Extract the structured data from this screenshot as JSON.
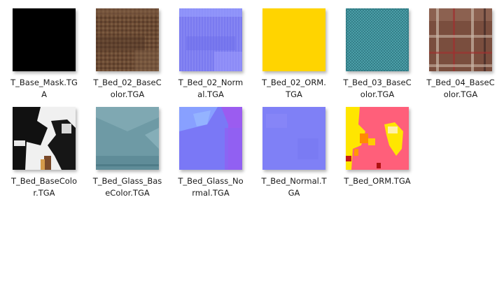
{
  "files": [
    {
      "id": "t-base-mask",
      "label": "T_Base_Mask.TG\nA",
      "swatch": "#000000"
    },
    {
      "id": "t-bed-02-basecolor",
      "label": "T_Bed_02_BaseC\nolor.TGA",
      "swatch": "#6b4a33"
    },
    {
      "id": "t-bed-02-normal",
      "label": "T_Bed_02_Norm\nal.TGA",
      "swatch": "#8080f0"
    },
    {
      "id": "t-bed-02-orm",
      "label": "T_Bed_02_ORM.\nTGA",
      "swatch": "#ffd400"
    },
    {
      "id": "t-bed-03-basecolor",
      "label": "T_Bed_03_BaseC\nolor.TGA",
      "swatch": "#3a8f9a"
    },
    {
      "id": "t-bed-04-basecolor",
      "label": "T_Bed_04_BaseC\nolor.TGA",
      "swatch": "#7a4a3c"
    },
    {
      "id": "t-bed-basecolor",
      "label": "T_Bed_BaseColo\nr.TGA",
      "swatch": "#f2f2f2"
    },
    {
      "id": "t-bed-glass-basecolor",
      "label": "T_Bed_Glass_Bas\neColor.TGA",
      "swatch": "#6f9aa6"
    },
    {
      "id": "t-bed-glass-normal",
      "label": "T_Bed_Glass_No\nrmal.TGA",
      "swatch": "#7a78f5"
    },
    {
      "id": "t-bed-normal",
      "label": "T_Bed_Normal.T\nGA",
      "swatch": "#7f80f6"
    },
    {
      "id": "t-bed-orm",
      "label": "T_Bed_ORM.TGA",
      "swatch": "#ff5f7a"
    }
  ]
}
